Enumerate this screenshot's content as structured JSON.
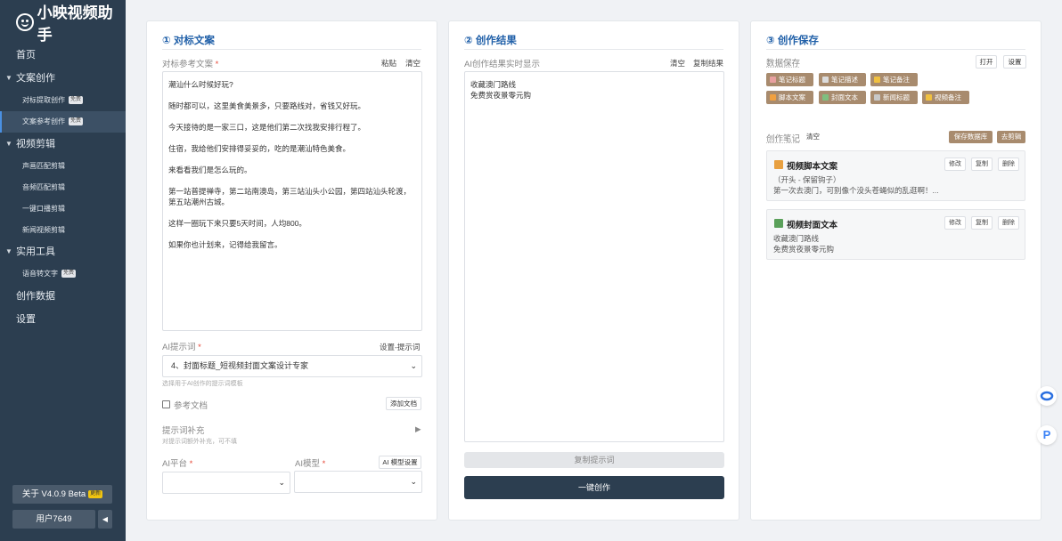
{
  "app": {
    "title": "小映视频助手"
  },
  "sidebar": {
    "home": "首页",
    "groups": [
      {
        "label": "文案创作",
        "items": [
          {
            "label": "对标提取创作",
            "badge": "免费"
          },
          {
            "label": "文案参考创作",
            "badge": "免费"
          }
        ]
      },
      {
        "label": "视频剪辑",
        "items": [
          {
            "label": "声画匹配剪辑"
          },
          {
            "label": "音频匹配剪辑"
          },
          {
            "label": "一键口播剪辑"
          },
          {
            "label": "新闻视频剪辑"
          }
        ]
      },
      {
        "label": "实用工具",
        "items": [
          {
            "label": "语音转文字",
            "badge": "免费"
          }
        ]
      }
    ],
    "data": "创作数据",
    "settings": "设置",
    "about": "关于 V4.0.9 Beta",
    "about_badge": "更新",
    "user": "用户7649",
    "collapse": "◀"
  },
  "panel1": {
    "title": "① 对标文案",
    "ref_label": "对标参考文案",
    "required": "*",
    "paste": "粘贴",
    "clear": "清空",
    "ref_text": "潮汕什么时候好玩?\n\n随时都可以，这里美食美景多，只要路线对，省钱又好玩。\n\n今天接待的是一家三口，这是他们第二次找我安排行程了。\n\n住宿，我给他们安排得妥妥的，吃的是潮汕特色美食。\n\n来看看我们是怎么玩的。\n\n第一站普提禅寺，第二站南澳岛，第三站汕头小公园，第四站汕头轮渡，第五站潮州古城。\n\n这样一圈玩下来只要5天时间，人均800。\n\n如果你也计划来，记得给我留言。",
    "prompt_label": "AI提示词",
    "prompt_settings": "设置-提示词",
    "prompt_value": "4、封面标题_短视频封面文案设计专家",
    "prompt_hint": "选择用于AI创作的提示词模板",
    "ref_doc_label": "参考文档",
    "add_doc": "添加文档",
    "supplement_label": "提示词补充",
    "supplement_hint": "对提示词额外补充，可不填",
    "platform_label": "AI平台",
    "model_label": "AI模型",
    "model_settings": "AI 模型设置",
    "platform_value": "",
    "model_value": ""
  },
  "panel2": {
    "title": "② 创作结果",
    "result_label": "AI创作结果实时显示",
    "clear": "清空",
    "copy_result": "复制结果",
    "result_text": "收藏澳门路线\n免费赏夜景零元购",
    "copy_prompt": "复制提示词",
    "create": "一键创作"
  },
  "panel3": {
    "title": "③ 创作保存",
    "data_save_label": "数据保存",
    "open": "打开",
    "settings": "设置",
    "tags": [
      {
        "label": "笔记标题",
        "icon_color": "#e8a0a0"
      },
      {
        "label": "笔记描述",
        "icon_color": "#dcdcdc"
      },
      {
        "label": "笔记备注",
        "icon_color": "#f0c040"
      },
      {
        "label": "脚本文案",
        "icon_color": "#f0a040"
      },
      {
        "label": "封面文本",
        "icon_color": "#7fbf7f"
      },
      {
        "label": "新闻标题",
        "icon_color": "#c8c8c8"
      },
      {
        "label": "视频备注",
        "icon_color": "#f0c040"
      }
    ],
    "notes_label": "创作笔记",
    "notes_clear": "清空",
    "save_db": "保存数据库",
    "to_edit": "去剪辑",
    "notes": [
      {
        "title": "视频脚本文案",
        "icon_color": "#e8a040",
        "body": "（开头 - 保留钩子）\n第一次去澳门，可别像个没头苍蝇似的乱逛啊！...",
        "edit": "修改",
        "copy": "复制",
        "delete": "删除"
      },
      {
        "title": "视频封面文本",
        "icon_color": "#5aa05a",
        "body": "收藏澳门路线\n免费赏夜景零元购",
        "edit": "修改",
        "copy": "复制",
        "delete": "删除"
      }
    ]
  },
  "colors": {
    "sidebar": "#2c3e50",
    "accent": "#1f5fa8",
    "tag": "#a88b6e",
    "primary_button": "#2c3e50"
  }
}
